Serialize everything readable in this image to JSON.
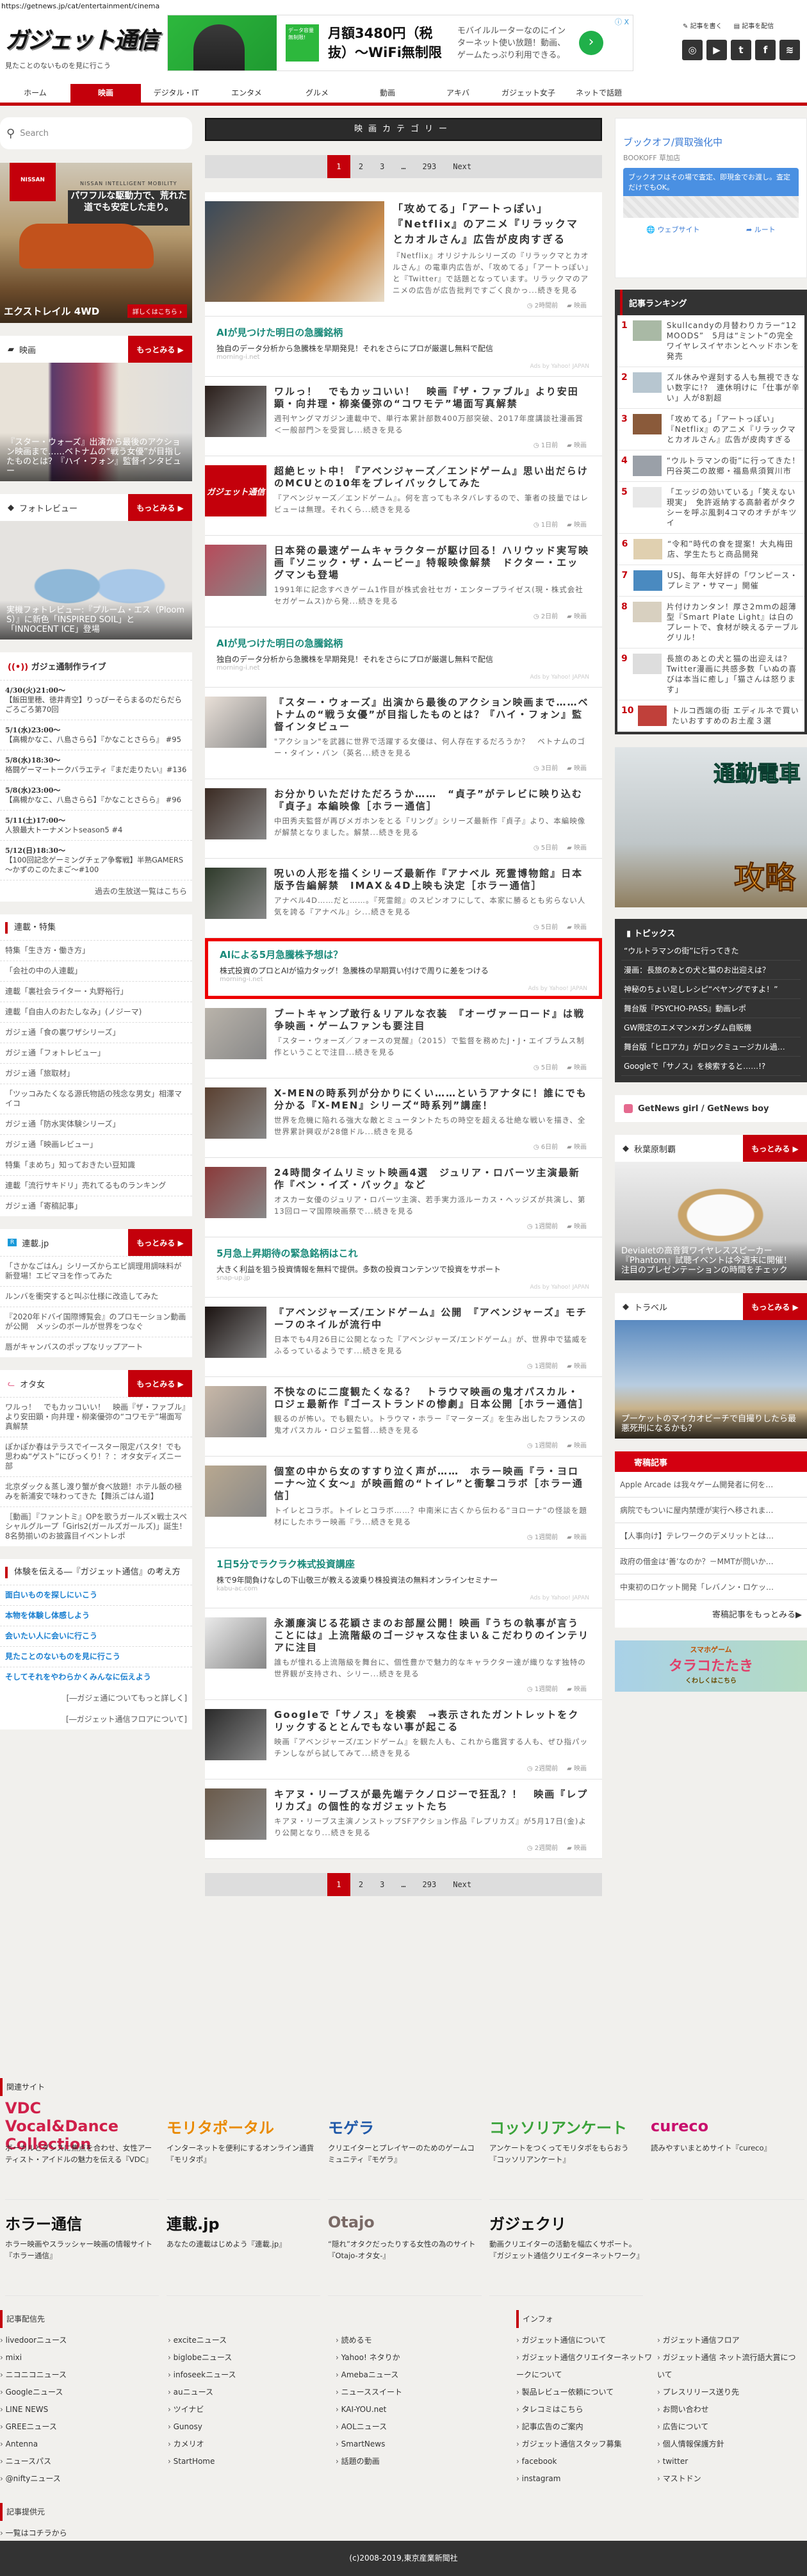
{
  "url": "https://getnews.jp/cat/entertainment/cinema",
  "header": {
    "logo": "ガジェット通信",
    "tagline": "見たことのないものを見に行こう",
    "write": "記事を書く",
    "distribute": "記事を配信",
    "ad": {
      "badge": "データ容量無制限!",
      "headline": "月額3480円（税抜）～WiFi無制限",
      "body": "モバイルルーターなのにインターネット使い放題！動画、ゲームたっぷり利用できる。",
      "next": "›",
      "info": "ⓘ X"
    },
    "social": [
      {
        "icon": "instagram-icon",
        "glyph": "◎"
      },
      {
        "icon": "youtube-icon",
        "glyph": "▶"
      },
      {
        "icon": "twitter-icon",
        "glyph": "t"
      },
      {
        "icon": "facebook-icon",
        "glyph": "f"
      },
      {
        "icon": "rss-icon",
        "glyph": "≋"
      }
    ]
  },
  "nav": [
    {
      "label": "ホーム"
    },
    {
      "label": "映画",
      "active": true
    },
    {
      "label": "デジタル・IT"
    },
    {
      "label": "エンタメ"
    },
    {
      "label": "グルメ"
    },
    {
      "label": "動画"
    },
    {
      "label": "アキバ"
    },
    {
      "label": "ガジェット女子"
    },
    {
      "label": "ネットで話題"
    }
  ],
  "search": {
    "placeholder": "Search"
  },
  "left": {
    "nissan": {
      "logo": "NISSAN",
      "mobility": "NISSAN INTELLIGENT MOBILITY",
      "copy": "パワフルな駆動力で、荒れた道でも安定した走り。",
      "model": "エクストレイル 4WD",
      "cta": "詳しくはこちら ›"
    },
    "more": "もっとみる ▶",
    "cinema": {
      "title": "映画",
      "caption": "『スター・ウォーズ』出演から最後のアクション映画まで……ベトナムの“戦う女優”が目指したものとは？『ハイ・フォン』監督インタビュー"
    },
    "photo": {
      "title": "フォトレビュー",
      "caption": "実機フォトレビュー:『プルーム・エス（Ploom S）』に新色「INSPIRED SOIL」と「INNOCENT ICE」登場"
    },
    "live": {
      "title": "ガジェ通制作ライブ",
      "items": [
        {
          "time": "4/30(火)21:00～",
          "text": "【飯田里穂、徳井青空】りっぴーそらまるのだらだらごろごろ第70回"
        },
        {
          "time": "5/1(水)23:00～",
          "text": "【高槻かなこ、八島さらら】『かなことさらら』 #95"
        },
        {
          "time": "5/8(水)18:30～",
          "text": "格闘ゲーマートークバラエティ『まだ走りたい』#136"
        },
        {
          "time": "5/8(水)23:00～",
          "text": "【高槻かなこ、八島さらら】『かなことさらら』 #96"
        },
        {
          "time": "5/11(土)17:00～",
          "text": "人狼最大トーナメントseason5 #4"
        },
        {
          "time": "5/12(日)18:30～",
          "text": "【100回記念ゲーミングチェア争奪戦】半熟GAMERS～かずのこのたまご～#100"
        }
      ],
      "past": "過去の生放送一覧はこちら"
    },
    "series": {
      "title": "連載・特集",
      "items": [
        "特集「生き方・働き方」",
        "「会社の中の人連載」",
        "連載「裏社会ライター・丸野裕行」",
        "連載「自由人のおたしなみ」(ノジーマ)",
        "ガジェ通「食の裏ワザシリーズ」",
        "ガジェ通「フォトレビュー」",
        "ガジェ通「旅取材」",
        "「ツッコみたくなる源氏物語の残念な男女」相澤マイコ",
        "ガジェ通「防水実体験シリーズ」",
        "ガジェ通「映画レビュー」",
        "特集「まめち」知っておきたい豆知識",
        "連載「流行サキドリ」売れてるものランキング",
        "ガジェ通「寄稿記事」"
      ]
    },
    "rensai": {
      "title": "連載.jp",
      "items": [
        "「さかなごはん」シリーズからエビ調理用調味料が新登場！エビマヨを作ってみた",
        "ルンバを衝突すると叫ぶ仕様に改造してみた",
        "『2020年ドバイ国際博覧会』のプロモーション動画が公開　メッシのボールが世界をつなぐ",
        "唇がキャンバスのポップなリップアート"
      ]
    },
    "otajo": {
      "title": "オタ女",
      "items": [
        "ワルっ！　でもカッコいい！　映画『ザ・ファブル』より安田顕・向井理・柳楽優弥の“コワモテ”場面写真解禁",
        "ぽかぽか春はテラスでイースター限定パスタ！でも思わぬ“ゲスト”にびっくり！？：オタ女ディズニー部",
        "北京ダック＆蒸し渡り蟹が食べ放題！ホテル飯の極みを新浦安で味わってきた【舞浜ごはん道】",
        "［動画］『ファントミ』OPを歌うガールズ×戦士スペシャルグループ「Girls2(ガールズガールズ)」誕生！8名勢揃いのお披露目イベントレポ"
      ]
    },
    "philosophy": {
      "title": "体験を伝える―『ガジェット通信』の考え方",
      "items": [
        "面白いものを探しにいこう",
        "本物を体験し体感しよう",
        "会いたい人に会いに行こう",
        "見たことのないものを見に行こう",
        "そしてそれをやわらかくみんなに伝えよう"
      ],
      "links": [
        "[―ガジェ通についてもっと詳しく]",
        "[―ガジェット通信フロアについて]"
      ]
    }
  },
  "main": {
    "category_title": "映画カテゴリー",
    "pagination": {
      "pages": [
        "1",
        "2",
        "3",
        "…",
        "293"
      ],
      "current": "1",
      "next": "Next"
    },
    "items": [
      {
        "type": "article",
        "big": true,
        "title": "「攻めてる」「アートっぽい」『Netflix』のアニメ『リラックマとカオルさん』広告が皮肉すぎる",
        "desc": "『Netflix』オリジナルシリーズの『リラックマとカオルさん』の電車内広告が、「攻めてる」「アートっぽい」と『Twitter』で話題となっています。リラックマのアニメの広告が広告批判ですごく良かっ...続きを見る",
        "time": "2時間前",
        "cat": "映画"
      },
      {
        "type": "ad",
        "title": "AIが見つけた明日の急騰銘柄",
        "desc": "独自のデータ分析から急騰株を早期発見！それをさらにプロが厳選し無料で配信",
        "domain": "morning-i.net",
        "by": "Ads by Yahoo! JAPAN"
      },
      {
        "type": "article",
        "title": "ワルっ！　でもカッコいい！　映画『ザ・ファブル』より安田顕・向井理・柳楽優弥の“コワモテ”場面写真解禁",
        "desc": "週刊ヤングマガジン連載中で、単行本累計部数400万部突破、2017年度講談社漫画賞＜一般部門＞を受賞し...続きを見る",
        "time": "1日前",
        "cat": "映画"
      },
      {
        "type": "article",
        "title": "超絶ヒット中！『アベンジャーズ／エンドゲーム』思い出だらけのMCUとの10年をプレイバックしてみた",
        "desc": "『アベンジャーズ／エンドゲーム』。何を言ってもネタバレするので、筆者の技量ではレビューは無理。それくら...続きを見る",
        "time": "1日前",
        "cat": "映画",
        "logo_thumb": "ガジェット通信"
      },
      {
        "type": "article",
        "title": "日本発の最速ゲームキャラクターが駆け回る！ハリウッド実写映画『ソニック・ザ・ムービー』特報映像解禁　ドクター・エッグマンも登場",
        "desc": "1991年に記念すべきゲーム1作目が株式会社セガ・エンタープライゼス(現・株式会社セガゲームス)から発...続きを見る",
        "time": "2日前",
        "cat": "映画"
      },
      {
        "type": "ad",
        "title": "AIが見つけた明日の急騰銘柄",
        "desc": "独自のデータ分析から急騰株を早期発見！それをさらにプロが厳選し無料で配信",
        "domain": "morning-i.net",
        "by": "Ads by Yahoo! JAPAN"
      },
      {
        "type": "article",
        "title": "『スター・ウォーズ』出演から最後のアクション映画まで……ベトナムの“戦う女優”が目指したものとは？『ハイ・フォン』監督インタビュー",
        "desc": "\"アクション\"を武器に世界で活躍する女優は、何人存在するだろうか？　ベトナムのゴー・タイン・バン（英名...続きを見る",
        "time": "3日前",
        "cat": "映画"
      },
      {
        "type": "article",
        "title": "お分かりいただけただろうか……　“貞子”がテレビに映り込む『貞子』本編映像［ホラー通信］",
        "desc": "中田秀夫監督が再びメガホンをとる『リング』シリーズ最新作『貞子』より、本編映像が解禁となりました。解禁...続きを見る",
        "time": "5日前",
        "cat": "映画"
      },
      {
        "type": "article",
        "title": "呪いの人形を描くシリーズ最新作『アナベル 死霊博物館』日本版予告編解禁　IMAX＆4D上映も決定［ホラー通信］",
        "desc": "アナベル4D……だと……。『死霊館』のスピンオフにして、本家に勝るとも劣らない人気を誇る『アナベル』シ...続きを見る",
        "time": "5日前",
        "cat": "映画"
      },
      {
        "type": "ad",
        "highlight": true,
        "title": "AIによる5月急騰株予想は？",
        "desc": "株式投資のプロとAIが協力タッグ！急騰株の早期買い付けで周りに差をつける",
        "domain": "morning-i.net",
        "by": "Ads by Yahoo! JAPAN"
      },
      {
        "type": "article",
        "title": "ブートキャンプ敢行＆リアルな衣装　『オーヴァーロード』は戦争映画・ゲームファンも要注目",
        "desc": "『スター・ウォーズ／フォースの覚醒』（2015）で監督を務めたJ・J・エイブラムス制作ということで注目...続きを見る",
        "time": "5日前",
        "cat": "映画"
      },
      {
        "type": "article",
        "title": "X-MENの時系列が分かりにくい……というアナタに！誰にでも分かる『X-MEN』シリーズ“時系列”講座！",
        "desc": "世界を危機に陥れる強大な敵とミュータントたちの時空を超える壮絶な戦いを描き、全世界累計興収が28億ドル...続きを見る",
        "time": "6日前",
        "cat": "映画"
      },
      {
        "type": "article",
        "title": "24時間タイムリミット映画4選　ジュリア・ロバーツ主演最新作『ベン・イズ・バック』など",
        "desc": "オスカー女優のジュリア・ロバーツ主演、若手実力派ルーカス・ヘッジズが共演し、第13回ローマ国際映画祭で...続きを見る",
        "time": "1週間前",
        "cat": "映画"
      },
      {
        "type": "ad",
        "title": "5月急上昇期待の緊急銘柄はこれ",
        "desc": "大きく利益を狙う投資情報を無料で提供。多数の投資コンテンツで投資をサポート",
        "domain": "snap-up.jp",
        "by": "Ads by Yahoo! JAPAN"
      },
      {
        "type": "article",
        "title": "『アベンジャーズ/エンドゲーム』公開　『アベンジャーズ』モチーフのネイルが流行中",
        "desc": "日本でも4月26日に公開となった『アベンジャーズ/エンドゲーム』が、世界中で猛威をふるっているようです...続きを見る",
        "time": "1週間前",
        "cat": "映画"
      },
      {
        "type": "article",
        "title": "不快なのに二度観たくなる？　トラウマ映画の鬼才パスカル・ロジェ最新作『ゴーストランドの惨劇』日本公開［ホラー通信］",
        "desc": "観るのが怖い。でも観たい。トラウマ・ホラー『マーターズ』を生み出したフランスの鬼才パスカル・ロジェ監督...続きを見る",
        "time": "1週間前",
        "cat": "映画"
      },
      {
        "type": "article",
        "title": "個室の中から女のすすり泣く声が……　ホラー映画『ラ・ヨローナ～泣く女～』が映画館の“トイレ”と衝撃コラボ［ホラー通信］",
        "desc": "トイレとコラボ。トイレとコラボ……？中南米に古くから伝わる“ヨローナ”の怪談を題材にしたホラー映画『ラ...続きを見る",
        "time": "1週間前",
        "cat": "映画"
      },
      {
        "type": "ad",
        "title": "1日5分でラクラク株式投資講座",
        "desc": "株で9年間負けなしの下山敬三が教える波乗り株投資法の無料オンラインセミナー",
        "domain": "kabu-ac.com",
        "by": "Ads by Yahoo! JAPAN"
      },
      {
        "type": "article",
        "title": "永瀬廉演じる花穎さまのお部屋公開！映画『うちの執事が言うことには』上流階級のゴージャスな住まい＆こだわりのインテリアに注目",
        "desc": "誰もが憧れる上流階級を舞台に、個性豊かで魅力的なキャラクター達が織りなす独特の世界観が支持され、シリー...続きを見る",
        "time": "1週間前",
        "cat": "映画"
      },
      {
        "type": "article",
        "title": "Googleで「サノス」を検索　→表示されたガントレットをクリックするととんでもない事が起こる",
        "desc": "映画『アベンジャーズ/エンドゲーム』を観た人も、これから鑑賞する人も、ぜひ指パッチンしながら試してみて...続きを見る",
        "time": "2週間前",
        "cat": "映画"
      },
      {
        "type": "article",
        "title": "キアヌ・リーブスが最先端テクノロジーで狂乱？！　映画『レプリカズ』の個性的なガジェットたち",
        "desc": "キアヌ・リーブス主演ノンストップSFアクション作品『レプリカズ』が5月17日(金)より公開となり...続きを見る",
        "time": "2週間前",
        "cat": "映画"
      }
    ]
  },
  "right": {
    "bookoff": {
      "title": "ブックオフ/買取強化中",
      "store": "BOOKOFF 草加店",
      "msg": "ブックオフはその場で査定、即現金でお渡し。査定だけでもOK。",
      "web": "ウェブサイト",
      "route": "ルート"
    },
    "ranking": {
      "title": "記事ランキング",
      "items": [
        {
          "n": "1",
          "title": "Skullcandyの月替わりカラー“12 MOODS”　5月は“ミント”の完全ワイヤレスイヤホンとヘッドホンを発売"
        },
        {
          "n": "2",
          "title": "ズル休みや遅刻する人も無視できない数字に!?　連休明けに「仕事が辛い」人が8割超"
        },
        {
          "n": "3",
          "title": "「攻めてる」「アートっぽい」『Netflix』のアニメ『リラックマとカオルさん』広告が皮肉すぎる"
        },
        {
          "n": "4",
          "title": "“ウルトラマンの街”に行ってきた！　円谷英二の故郷・福島県須賀川市"
        },
        {
          "n": "5",
          "title": "「エッジの効いている」「笑えない現実」　免許返納する高齢者がタクシーを呼ぶ風刺4コマのオチがキツイ"
        },
        {
          "n": "6",
          "title": "“令和”時代の食を提案！大丸梅田店、学生たちと商品開発"
        },
        {
          "n": "7",
          "title": "USJ、毎年大好評の「ワンピース・プレミア・サマー」開催"
        },
        {
          "n": "8",
          "title": "片付けカンタン！厚さ2mmの超薄型『Smart Plate Light』は白のプレートで、食材が映えるテーブルグリル！"
        },
        {
          "n": "9",
          "title": "長旅のあとの犬と猫の出迎えは？　Twitter漫画に共感多数「いぬの喜びは本当に癒し」「猫さんは怒ります」"
        },
        {
          "n": "10",
          "title": "トルコ西端の街 エディルネで買いたいおすすめのお土産３選"
        }
      ]
    },
    "commute": {
      "line1": "通勤電車",
      "line2": "攻略"
    },
    "topics": {
      "title": "トピックス",
      "items": [
        "“ウルトラマンの街”に行ってきた",
        "漫画：長旅のあとの犬と猫のお出迎えは？",
        "神秘のちょい足しレシピ“ぺヤングですよ！”",
        "舞台版『PSYCHO-PASS』動画レポ",
        "GW限定のエメマン×ガンダム自販機",
        "舞台版「ヒロアカ」がロックミュージカル過…",
        "Googleで「サノス」を検索すると……!?"
      ]
    },
    "getnews": "GetNews girl / GetNews boy",
    "more": "もっとみる ▶",
    "akiba": {
      "title": "秋葉原制覇",
      "caption": "Devialetの高音質ワイヤレススピーカー『Phantom』試聴イベントは今週末に開催！　注目のプレゼンテーションの時間をチェック"
    },
    "travel": {
      "title": "トラベル",
      "caption": "プーケットのマイカオビーチで自撮りしたら最悪死刑になるかも？"
    },
    "kikou": {
      "title": "寄稿記事",
      "items": [
        "Apple Arcade は我々ゲーム開発者に何を…",
        "病院でもついに屋内禁煙が実行へ移されま…",
        "【人事向け】テレワークのデメリットとは…",
        "政府の借金は‘善’なのか？－MMTが問いか…",
        "中東初のロケット開発「レバノン・ロケッ…"
      ],
      "more": "寄稿記事をもっとみる▶"
    },
    "tarako": {
      "line1": "スマホゲーム",
      "line2": "タラコたたき",
      "line3": "くわしくはこちら"
    }
  },
  "footer": {
    "related_title": "関連サイト",
    "sites": [
      {
        "logo": "VDC Vocal&Dance Collection",
        "color": "#d0204a",
        "desc": "ボーカルとダンスに焦点を合わせ、女性アーティスト・アイドルの魅力を伝える『VDC』"
      },
      {
        "logo": "モリタポータル",
        "color": "#e98a00",
        "desc": "インターネットを便利にするオンライン通貨『モリタポ』"
      },
      {
        "logo": "モゲラ",
        "color": "#1f58a8",
        "desc": "クリエイターとプレイヤーのためのゲームコミュニティ『モゲラ』"
      },
      {
        "logo": "コッソリアンケート",
        "color": "#3aa33a",
        "desc": "アンケートをつくってモリタポをもらおう『コッソリアンケート』"
      },
      {
        "logo": "cureco",
        "color": "#c8106e",
        "desc": "読みやすいまとめサイト『cureco』"
      },
      {
        "logo": "ホラー通信",
        "color": "#111",
        "desc": "ホラー映画やスラッシャー映画の情報サイト『ホラー通信』"
      },
      {
        "logo": "連載.jp",
        "color": "#111",
        "desc": "あなたの連載はじめよう『連載.jp』"
      },
      {
        "logo": "Otajo",
        "color": "#7a6a66",
        "desc": "“隠れ”オタクだったりする女性の為のサイト『Otajo-オタ女-』"
      },
      {
        "logo": "ガジェクリ",
        "color": "#111",
        "desc": "動画クリエイターの活動を幅広くサポート。『ガジェット通信クリエイターネットワーク』"
      }
    ],
    "dist_title": "記事配信先",
    "dist": [
      [
        "livedoorニュース",
        "mixi",
        "ニコニコニュース",
        "Googleニュース",
        "LINE NEWS",
        "GREEニュース",
        "Antenna",
        "ニュースパス",
        "@niftyニュース"
      ],
      [
        "exciteニュース",
        "biglobeニュース",
        "infoseekニュース",
        "auニュース",
        "ツイナビ",
        "Gunosy",
        "カメリオ",
        "StartHome"
      ],
      [
        "読めるモ",
        "Yahoo! ネタりか",
        "Amebaニュース",
        "ニューススイート",
        "KAI-YOU.net",
        "AOLニュース",
        "SmartNews",
        "話題の動画"
      ]
    ],
    "info_title": "インフォ",
    "info": [
      [
        "ガジェット通信について",
        "ガジェット通信クリエイターネットワークについて",
        "製品レビュー依頼について",
        "タレコミはこちら",
        "記事広告のご案内",
        "ガジェット通信スタッフ募集",
        "facebook",
        "instagram"
      ],
      [
        "ガジェット通信フロア",
        "ガジェット通信 ネット流行語大賞について",
        "プレスリリース送り先",
        "お問い合わせ",
        "広告について",
        "個人情報保護方針",
        "twitter",
        "マストドン"
      ]
    ],
    "src_title": "記事提供元",
    "src": [
      "一覧はコチラから"
    ],
    "copyright": "(c)2008-2019,東京産業新聞社"
  }
}
